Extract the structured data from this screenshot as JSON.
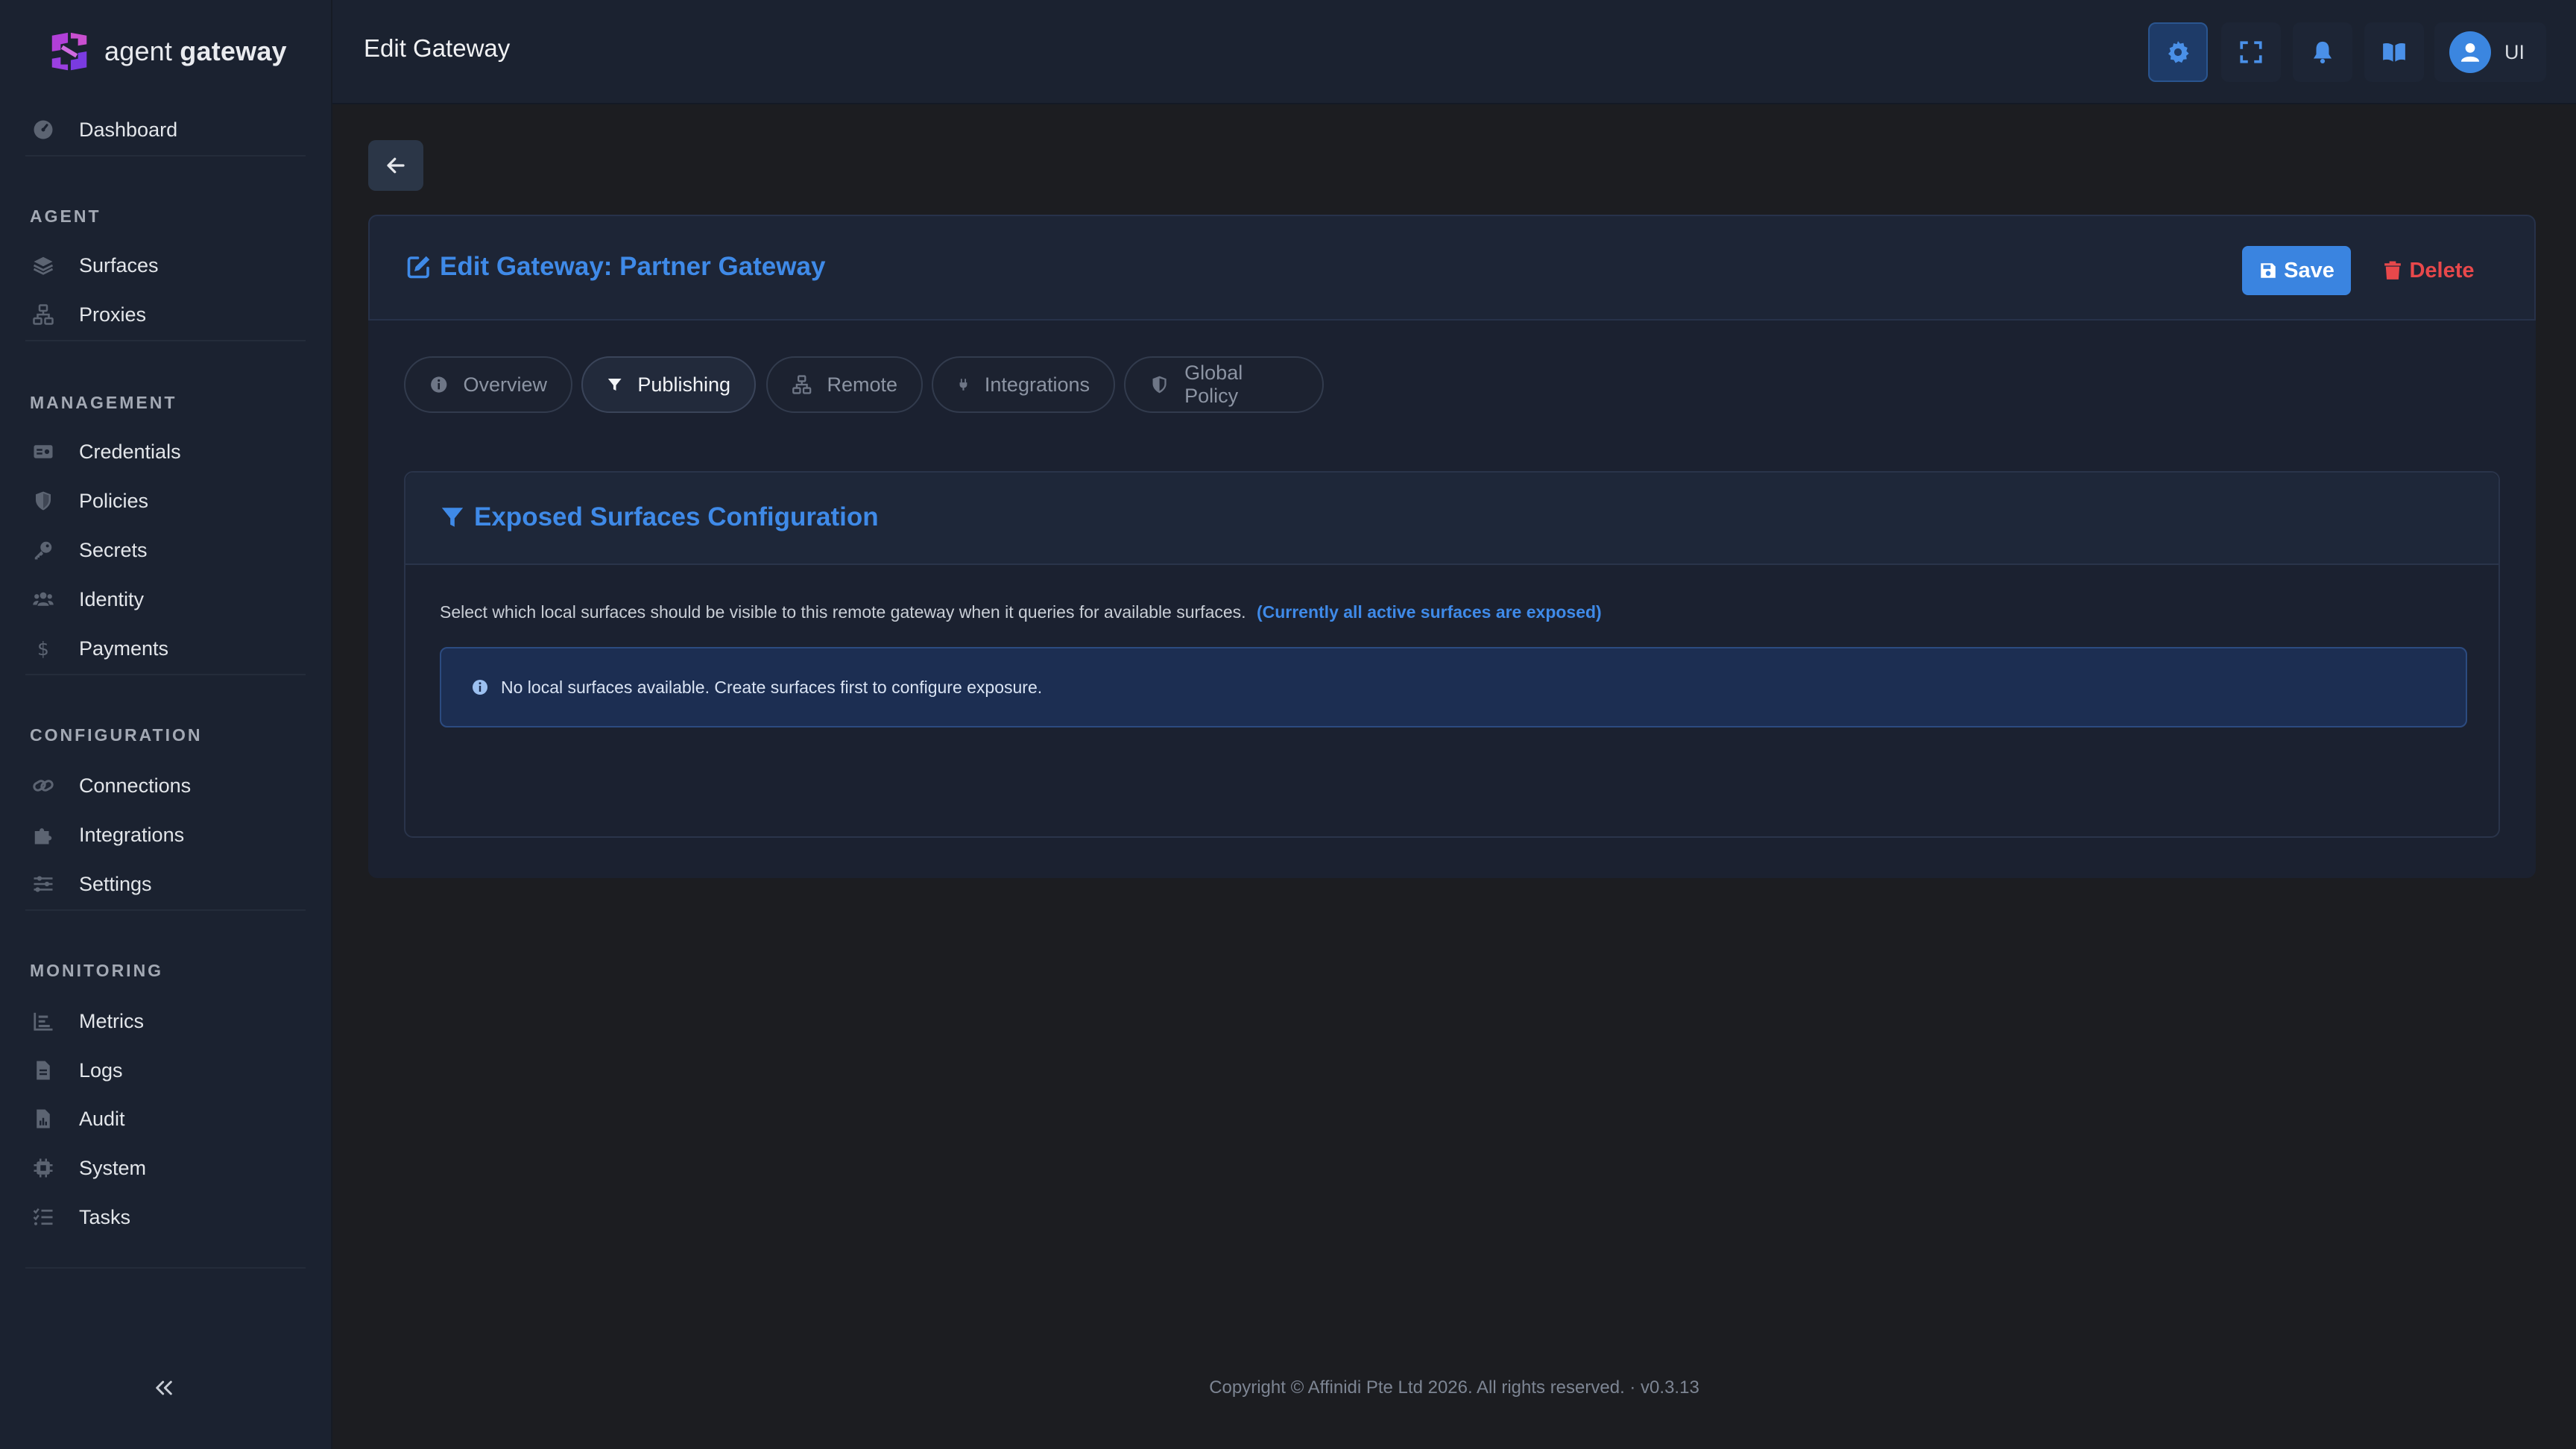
{
  "brand": {
    "prefix": "agent",
    "name": "gateway"
  },
  "sidebar": {
    "dashboard": "Dashboard",
    "sections": {
      "agent": "AGENT",
      "management": "MANAGEMENT",
      "configuration": "CONFIGURATION",
      "monitoring": "MONITORING"
    },
    "items": {
      "surfaces": "Surfaces",
      "proxies": "Proxies",
      "credentials": "Credentials",
      "policies": "Policies",
      "secrets": "Secrets",
      "identity": "Identity",
      "payments": "Payments",
      "connections": "Connections",
      "integrations": "Integrations",
      "settings": "Settings",
      "metrics": "Metrics",
      "logs": "Logs",
      "audit": "Audit",
      "system": "System",
      "tasks": "Tasks"
    }
  },
  "header": {
    "title": "Edit Gateway",
    "user_label": "UI"
  },
  "card": {
    "title": "Edit Gateway: Partner Gateway",
    "save_label": "Save",
    "delete_label": "Delete"
  },
  "tabs": [
    "Overview",
    "Publishing",
    "Remote",
    "Integrations",
    "Global Policy"
  ],
  "active_tab": "Publishing",
  "panel": {
    "title": "Exposed Surfaces Configuration",
    "description": "Select which local surfaces should be visible to this remote gateway when it queries for available surfaces.",
    "highlight": "(Currently all active surfaces are exposed)",
    "alert": "No local surfaces available. Create surfaces first to configure exposure."
  },
  "footer": "Copyright © Affinidi Pte Ltd 2026. All rights reserved. · v0.3.13",
  "colors": {
    "accent": "#3f8ae8",
    "danger": "#e8484b",
    "brand": "#b13fd8"
  }
}
